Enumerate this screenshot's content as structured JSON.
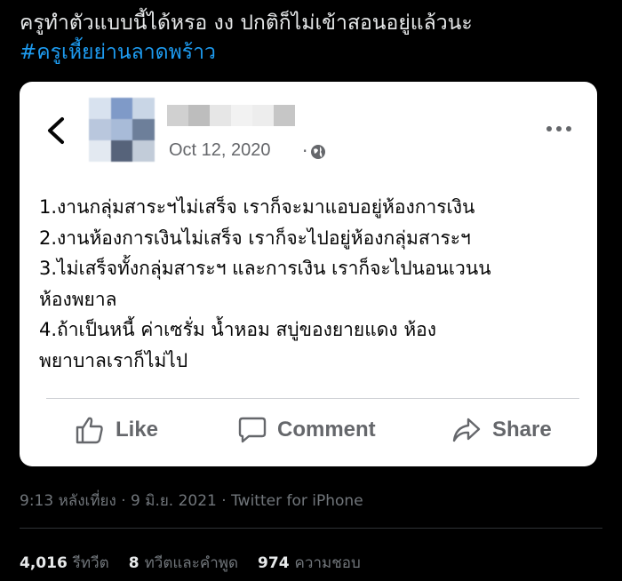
{
  "tweet": {
    "text": "ครูทำตัวแบบนี้ได้หรอ งง ปกติก็ไม่เข้าสอนอยู่แล้วนะ",
    "hashtag": "#ครูเหี้ยย่านลาดพร้าว",
    "time": "9:13 หลังเที่ยง",
    "date": "9 มิ.ย. 2021",
    "source": "Twitter for iPhone",
    "separator": " · ",
    "stats": {
      "retweets_count": "4,016",
      "retweets_label": "รีทวีต",
      "quotes_count": "8",
      "quotes_label": "ทวีตและคำพูด",
      "likes_count": "974",
      "likes_label": "ความชอบ"
    }
  },
  "facebook_post": {
    "date": "Oct 12, 2020",
    "dot": "·",
    "lines": [
      "1.งานกลุ่มสาระฯไม่เสร็จ เราก็จะมาแอบอยู่ห้องการเงิน",
      "2.งานห้องการเงินไม่เสร็จ เราก็จะไปอยู่ห้องกลุ่มสาระฯ",
      "3.ไม่เสร็จทั้งกลุ่มสาระฯ และการเงิน เราก็จะไปนอนเวนน",
      "ห้องพยาล",
      "4.ถ้าเป็นหนี้ ค่าเซรั่ม น้ำหอม สบู่ของยายแดง ห้อง",
      "พยาบาลเราก็ไม่ไป"
    ],
    "actions": {
      "like": "Like",
      "comment": "Comment",
      "share": "Share"
    }
  },
  "icons": {
    "back": "chevron-left-icon",
    "globe": "globe-icon",
    "more": "more-horizontal-icon",
    "like": "thumbs-up-icon",
    "comment": "comment-bubble-icon",
    "share": "share-arrow-icon"
  },
  "colors": {
    "background": "#000000",
    "hashtag": "#1d9bf0",
    "card": "#ffffff",
    "fb_secondary": "#65676b",
    "muted": "#71767b"
  }
}
